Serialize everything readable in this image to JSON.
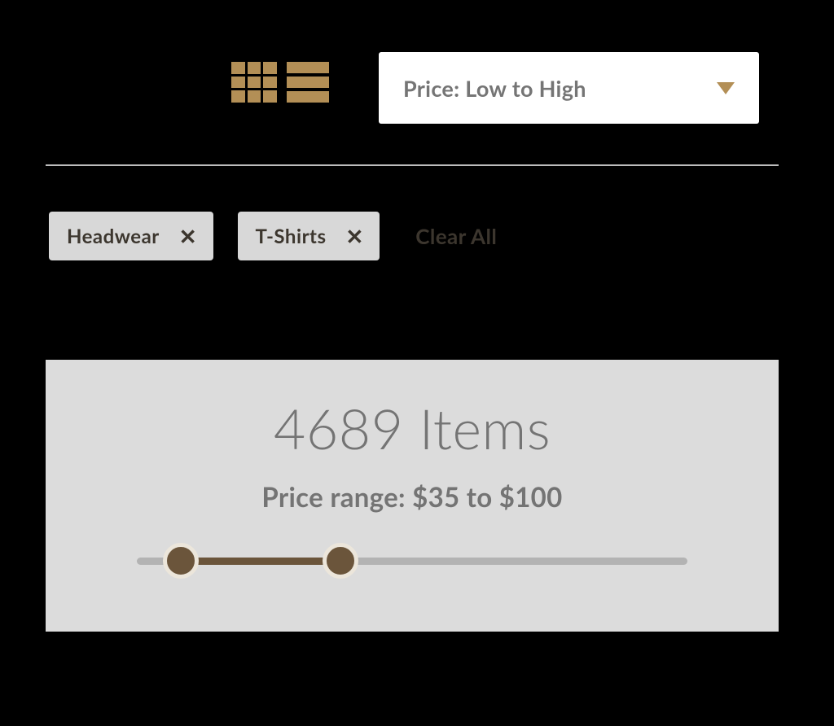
{
  "toolbar": {
    "sort_label": "Price: Low to High"
  },
  "filters": {
    "chips": [
      {
        "label": "Headwear"
      },
      {
        "label": "T-Shirts"
      }
    ],
    "clear_all_label": "Clear All"
  },
  "results": {
    "count_text": "4689 Items",
    "price_range_text": "Price range: $35 to $100",
    "slider": {
      "min_pct": 8,
      "max_pct": 37
    }
  }
}
